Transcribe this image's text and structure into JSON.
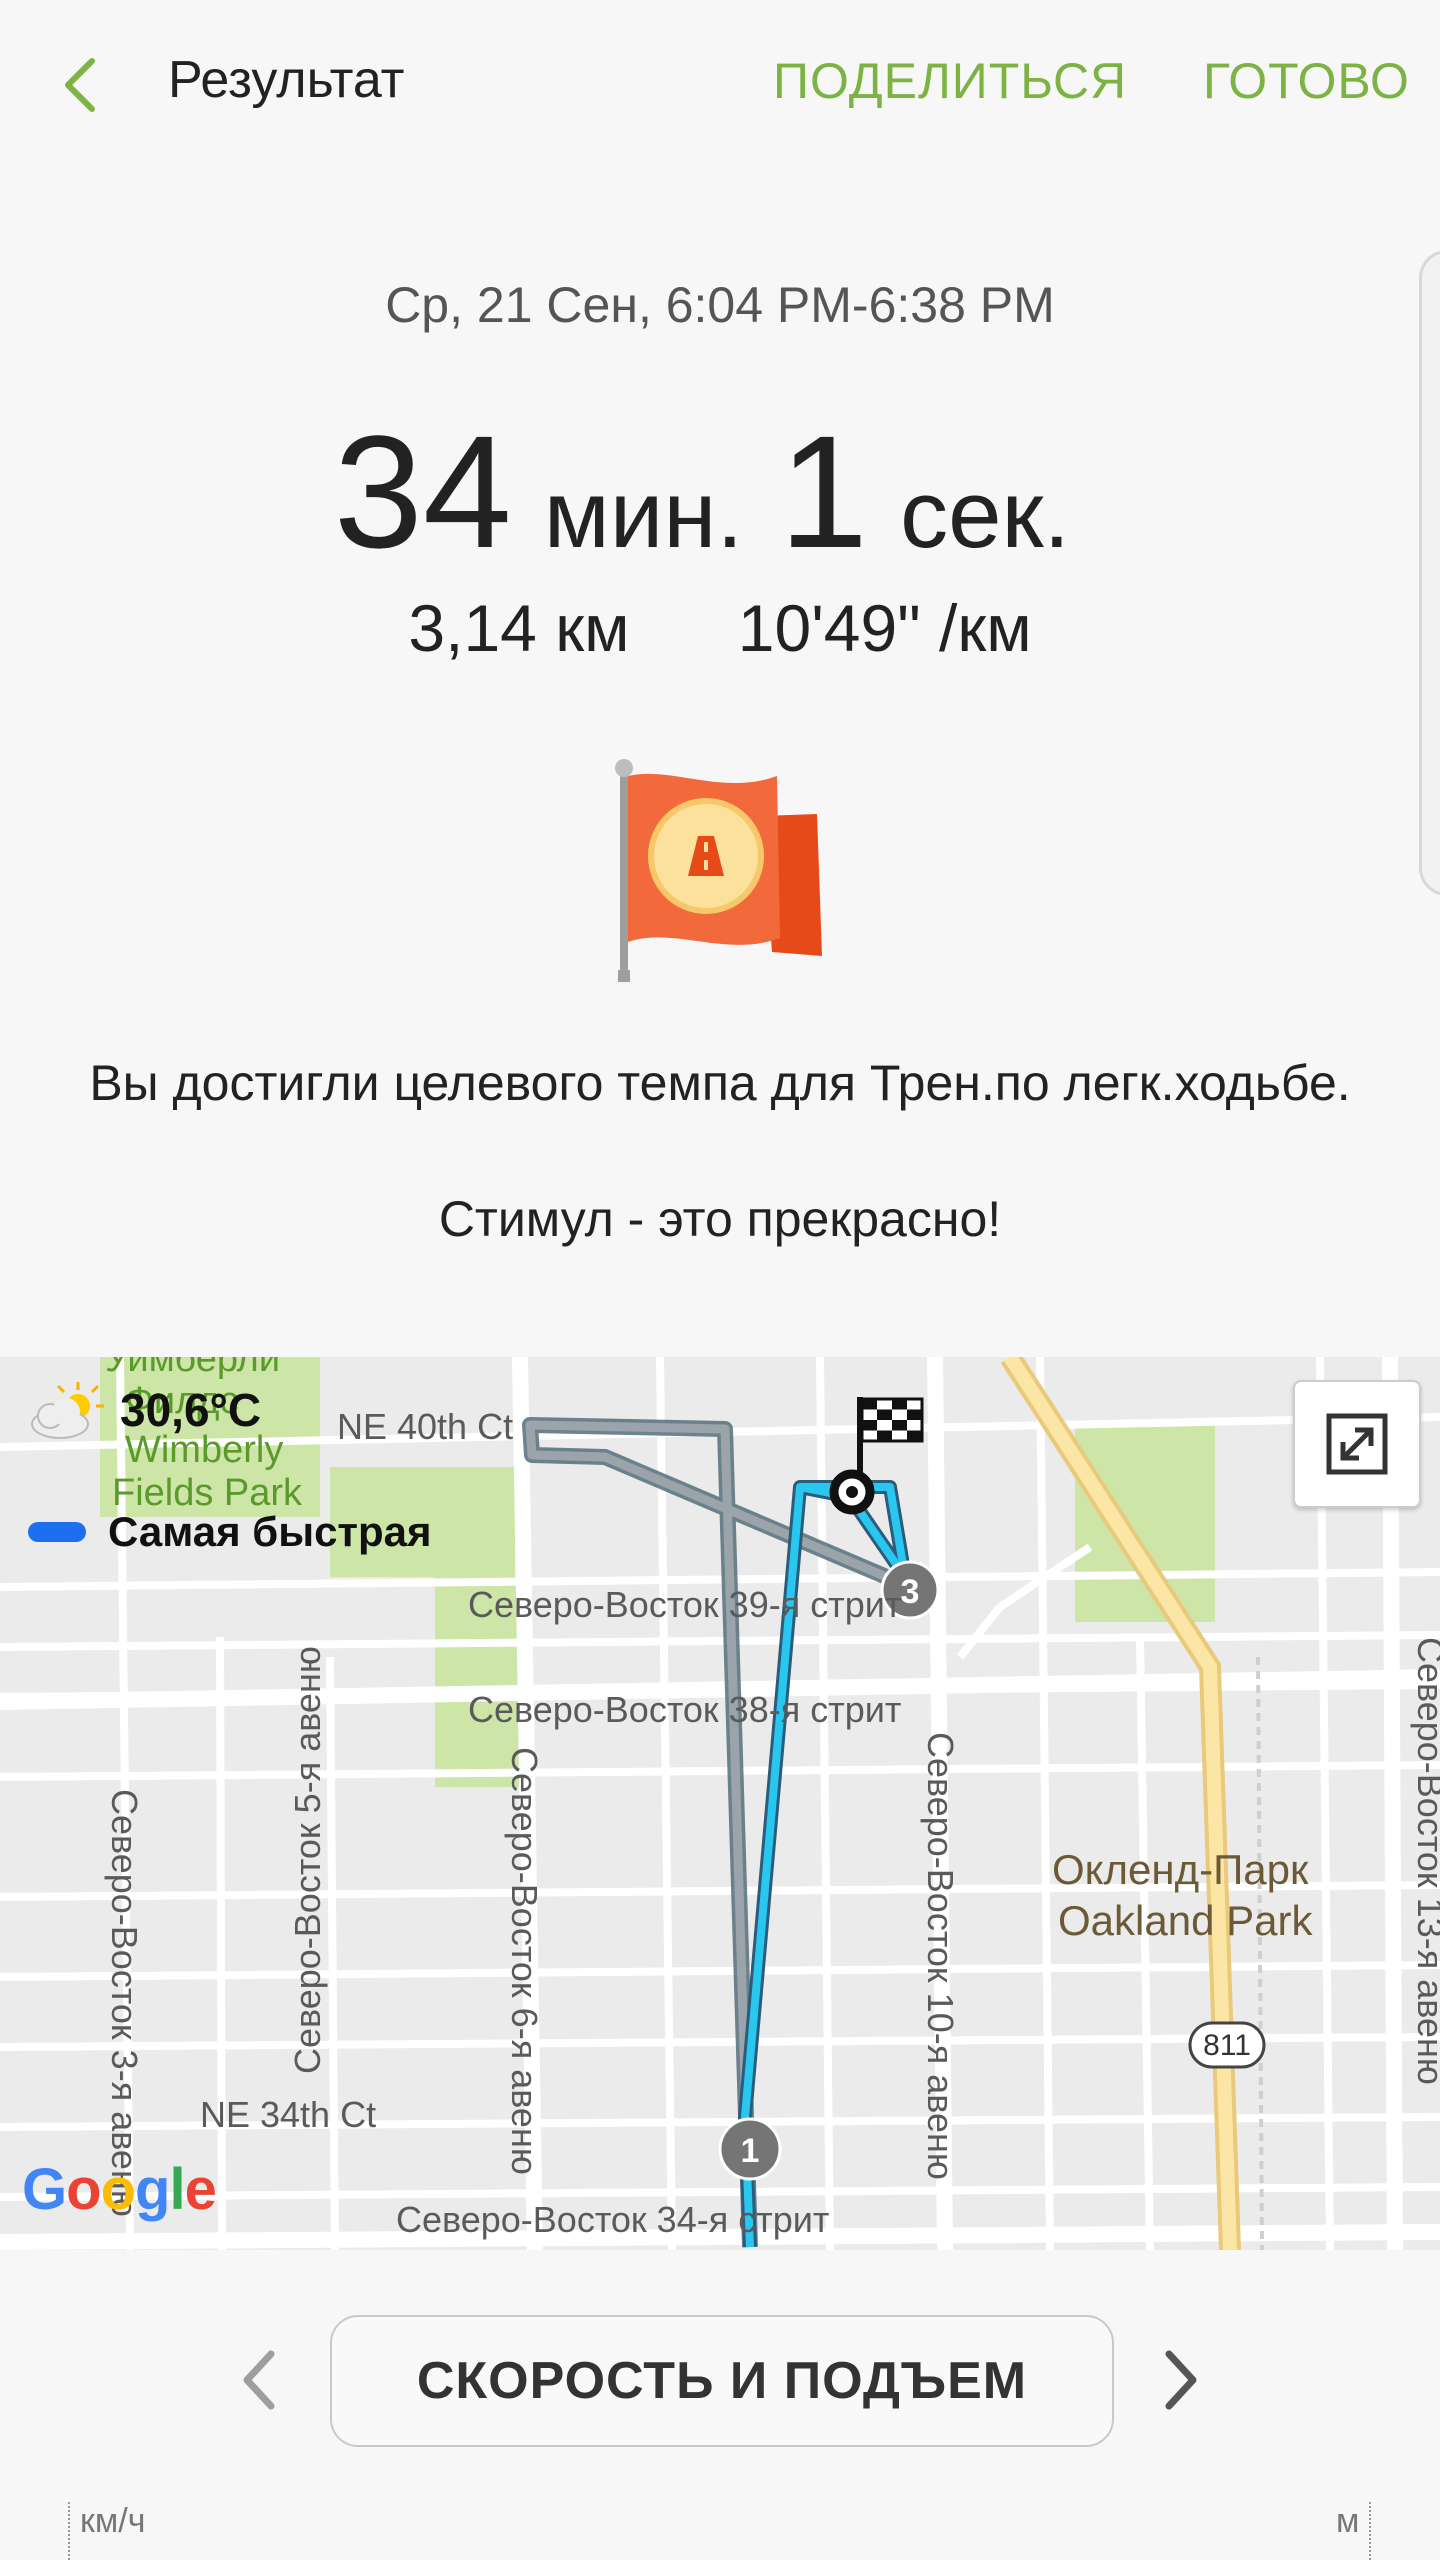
{
  "header": {
    "title": "Результат",
    "share_label": "ПОДЕЛИТЬСЯ",
    "done_label": "ГОТОВО"
  },
  "summary": {
    "date_range": "Ср, 21 Сен, 6:04 PM-6:38 PM",
    "duration_minutes": "34",
    "minutes_unit": "мин.",
    "duration_seconds": "1",
    "seconds_unit": "сек.",
    "distance": "3,14 км",
    "pace": "10'49\" /км"
  },
  "achievement": {
    "message_line1": "Вы достигли целевого темпа для Трен.по легк.ходьбе.",
    "message_line2": "Стимул - это прекрасно!"
  },
  "map": {
    "weather_temp": "30,6°C",
    "legend_label": "Самая быстрая",
    "route_color": "#29c7f0",
    "legend_color": "#1e6ff0",
    "markers": [
      "1",
      "3"
    ],
    "labels": {
      "park_ru": "Уимберли",
      "park_ru2": "Филдс",
      "park_en1": "Wimberly",
      "park_en2": "Fields Park",
      "ne40": "NE 40th Ct",
      "st39": "Северо-Восток 39-я стрит",
      "st38": "Северо-Восток 38-я стрит",
      "ne34ct": "NE 34th Ct",
      "st34": "Северо-Восток 34-я стрит",
      "av3": "Северо-Восток 3-я авеню",
      "av5": "Северо-Восток 5-я авеню",
      "av6": "Северо-Восток 6-я авеню",
      "av10": "Северо-Восток 10-я авеню",
      "av13": "Северо-Восток 13-я авеню",
      "oakland_ru": "Окленд-Парк",
      "oakland_en": "Oakland Park",
      "hwy": "811"
    },
    "google_letters": [
      "G",
      "o",
      "o",
      "g",
      "l",
      "e"
    ]
  },
  "bottom": {
    "chart_button": "СКОРОСТЬ И ПОДЪЕМ",
    "axis_left": "км/ч",
    "axis_right": "м"
  }
}
